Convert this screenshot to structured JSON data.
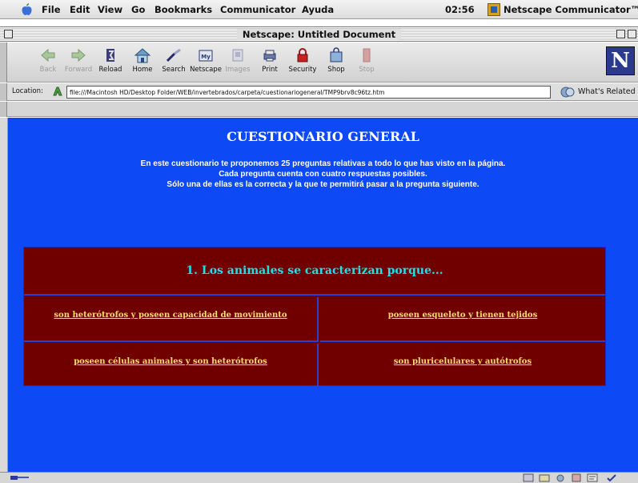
{
  "menubar": {
    "items": [
      "File",
      "Edit",
      "View",
      "Go",
      "Bookmarks",
      "Communicator",
      "Ayuda"
    ],
    "clock": "02:56",
    "app_name": "Netscape Communicator™"
  },
  "window": {
    "title": "Netscape: Untitled Document"
  },
  "toolbar": {
    "buttons": [
      {
        "label": "Back",
        "icon": "back-arrow-icon",
        "enabled": false
      },
      {
        "label": "Forward",
        "icon": "forward-arrow-icon",
        "enabled": false
      },
      {
        "label": "Reload",
        "icon": "reload-icon",
        "enabled": true
      },
      {
        "label": "Home",
        "icon": "home-icon",
        "enabled": true
      },
      {
        "label": "Search",
        "icon": "search-icon",
        "enabled": true
      },
      {
        "label": "Netscape",
        "icon": "netscape-icon",
        "enabled": true
      },
      {
        "label": "Images",
        "icon": "images-icon",
        "enabled": false
      },
      {
        "label": "Print",
        "icon": "print-icon",
        "enabled": true
      },
      {
        "label": "Security",
        "icon": "security-lock-icon",
        "enabled": true
      },
      {
        "label": "Shop",
        "icon": "shop-icon",
        "enabled": true
      },
      {
        "label": "Stop",
        "icon": "stop-icon",
        "enabled": false
      }
    ],
    "logo": "N"
  },
  "location": {
    "label": "Location:",
    "url": "file:///Macintosh HD/Desktop Folder/WEB/invertebrados/carpeta/cuestionariogeneral/TMP9brv8c96tz.htm",
    "whats_related": "What's Related"
  },
  "page": {
    "title": "CUESTIONARIO GENERAL",
    "intro": [
      "En este cuestionario te proponemos 25 preguntas relativas a todo lo que has visto en la página.",
      "Cada pregunta cuenta con cuatro respuestas posibles.",
      "Sólo una de ellas es la correcta y la que te permitirá pasar a la pregunta siguiente."
    ],
    "question": "1. Los animales se caracterizan porque...",
    "answers": [
      "son heterótrofos y poseen capacidad de movimiento",
      "poseen esqueleto y tienen tejidos",
      "poseen células animales y son heterótrofos",
      "son pluricelulares y autótrofos"
    ]
  },
  "colors": {
    "page_background": "#0d49f5",
    "table_background": "#700000",
    "question_text": "#1ee0e8",
    "answer_link": "#ffde6a"
  }
}
